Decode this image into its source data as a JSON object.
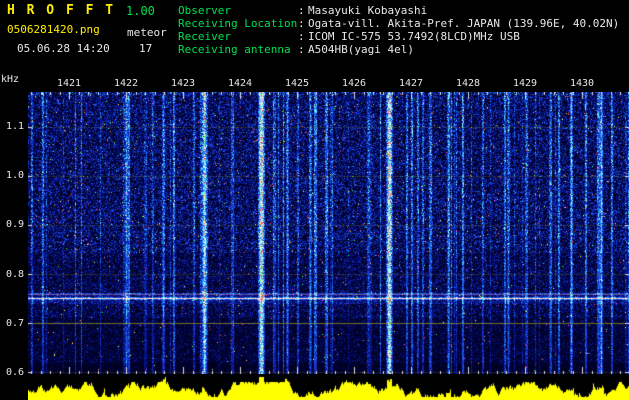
{
  "app": {
    "title": "H R O F F T",
    "version": "1.00",
    "filename": "0506281420.png",
    "mode": "meteor",
    "datetime": "05.06.28 14:20",
    "count": "17"
  },
  "info": {
    "separator": ":",
    "rows": [
      {
        "label": "Observer",
        "value": "Masayuki Kobayashi"
      },
      {
        "label": "Receiving Location",
        "value": "Ogata-vill. Akita-Pref. JAPAN (139.96E, 40.02N)"
      },
      {
        "label": "Receiver",
        "value": "ICOM IC-575 53.7492(8LCD)MHz USB"
      },
      {
        "label": "Receiving antenna",
        "value": "A504HB(yagi 4el)"
      }
    ]
  },
  "chart_data": {
    "type": "heatmap",
    "x_axis": {
      "tick_labels": [
        "1421",
        "1422",
        "1423",
        "1424",
        "1425",
        "1426",
        "1427",
        "1428",
        "1429",
        "1430"
      ]
    },
    "y_axis": {
      "unit": "kHz",
      "tick_labels": [
        "1.1",
        "1.0",
        "0.9",
        "0.8",
        "0.7",
        "0.6"
      ],
      "range": [
        0.598,
        1.171
      ]
    },
    "carrier_khz": 0.75,
    "secondary_line_khz": 0.762,
    "gridline_khz": [
      1.1,
      1.0,
      0.9,
      0.8,
      0.7,
      0.6
    ],
    "echo_columns": [
      {
        "pos": 0.163,
        "strength": 0.5
      },
      {
        "pos": 0.225,
        "strength": 0.4
      },
      {
        "pos": 0.294,
        "strength": 0.75
      },
      {
        "pos": 0.389,
        "strength": 1.0
      },
      {
        "pos": 0.432,
        "strength": 0.45
      },
      {
        "pos": 0.47,
        "strength": 0.4
      },
      {
        "pos": 0.602,
        "strength": 0.95
      },
      {
        "pos": 0.7,
        "strength": 0.45
      },
      {
        "pos": 0.8,
        "strength": 0.4
      },
      {
        "pos": 0.905,
        "strength": 0.55
      },
      {
        "pos": 0.955,
        "strength": 0.6
      }
    ],
    "strength_bar_color": "#ffff00",
    "palette": {
      "background": "#000022",
      "noise_low": "#02085c",
      "noise_mid": "#1a3eda",
      "noise_high": "#5ce2ff",
      "peak": "#ffee96",
      "max": "#ff5c5c"
    }
  },
  "colors": {
    "accent_yellow": "#ffee00",
    "accent_green": "#00e050",
    "text_white": "#e8e8e8"
  }
}
